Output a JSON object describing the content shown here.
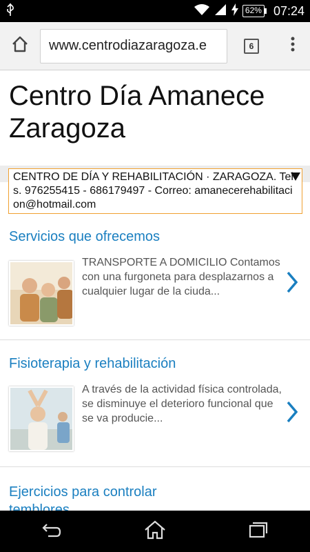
{
  "status": {
    "battery": "62%",
    "time": "07:24"
  },
  "browser": {
    "url": "www.centrodiazaragoza.e",
    "tab_count": "6"
  },
  "page": {
    "title": "Centro Día Amanece Zaragoza",
    "ticker": "CENTRO DE DÍA Y REHABILITACIÓN · ZARAGOZA. Tels. 976255415 - 686179497 - Correo: amanecerehabilitacion@hotmail.com",
    "sections": [
      {
        "title": "Servicios que ofrecemos",
        "text": "TRANSPORTE A DOMICILIO Contamos con una furgoneta para desplazarnos a cualquier lugar de la ciuda..."
      },
      {
        "title": "Fisioterapia y rehabilitación",
        "text": "A través de la actividad física controlada, se disminuye el deterioro funcional que se va producie..."
      },
      {
        "title": "Ejercicios para controlar temblores",
        "text": ""
      }
    ]
  },
  "colors": {
    "link": "#1a7fc0",
    "ticker_border": "#f0a030"
  }
}
